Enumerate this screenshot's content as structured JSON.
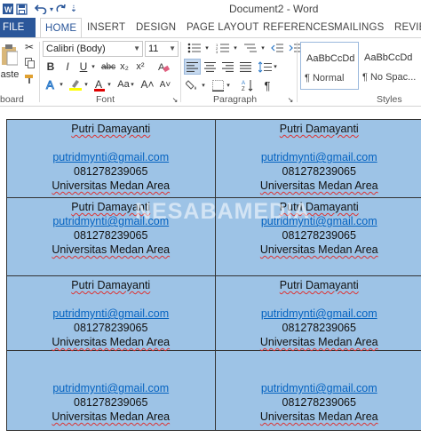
{
  "window": {
    "title": "Document2 - Word"
  },
  "tabs": [
    "FILE",
    "HOME",
    "INSERT",
    "DESIGN",
    "PAGE LAYOUT",
    "REFERENCES",
    "MAILINGS",
    "REVIEW"
  ],
  "ribbon": {
    "clipboard": {
      "paste_label": "aste",
      "group_label": "board"
    },
    "font": {
      "name": "Calibri (Body)",
      "size": "11",
      "group_label": "Font",
      "buttons": {
        "bold": "B",
        "italic": "I",
        "underline": "U",
        "strike": "abc",
        "subscript": "x₂",
        "superscript": "x²"
      }
    },
    "paragraph": {
      "group_label": "Paragraph"
    },
    "styles": {
      "group_label": "Styles",
      "items": [
        {
          "sample": "AaBbCcDd",
          "name": "¶ Normal"
        },
        {
          "sample": "AaBbCcDd",
          "name": "¶ No Spac..."
        }
      ]
    }
  },
  "watermark": "NESABAMEDIA",
  "labels": [
    {
      "name": "Putri Damayanti",
      "email": "putridmynti@gmail.com",
      "phone": "081278239065",
      "uni": "Universitas Medan Area",
      "blank_before_email": true
    },
    {
      "name": "Putri Damayanti",
      "email": "putridmynti@gmail.com",
      "phone": "081278239065",
      "uni": "Universitas Medan Area",
      "blank_before_email": true
    },
    {
      "name": "Putri Damayanti",
      "email": "putridmynti@gmail.com",
      "phone": "081278239065",
      "uni": "Universitas Medan Area",
      "blank_before_email": false
    },
    {
      "name": "Putri Damayanti",
      "email": "putridmynti@gmail.com",
      "phone": "081278239065",
      "uni": "Universitas Medan Area",
      "blank_before_email": false
    },
    {
      "name": "Putri Damayanti",
      "email": "putridmynti@gmail.com",
      "phone": "081278239065",
      "uni": "Universitas Medan Area",
      "blank_before_email": true
    },
    {
      "name": "Putri Damayanti",
      "email": "putridmynti@gmail.com",
      "phone": "081278239065",
      "uni": "Universitas Medan Area",
      "blank_before_email": true
    },
    {
      "name": "",
      "email": "putridmynti@gmail.com",
      "phone": "081278239065",
      "uni": "Universitas Medan Area",
      "blank_before_email": true
    },
    {
      "name": "",
      "email": "putridmynti@gmail.com",
      "phone": "081278239065",
      "uni": "Universitas Medan Area",
      "blank_before_email": true
    }
  ],
  "colors": {
    "accent": "#2b579a",
    "cell_fill": "#9dc3e6",
    "link": "#0563c1"
  }
}
